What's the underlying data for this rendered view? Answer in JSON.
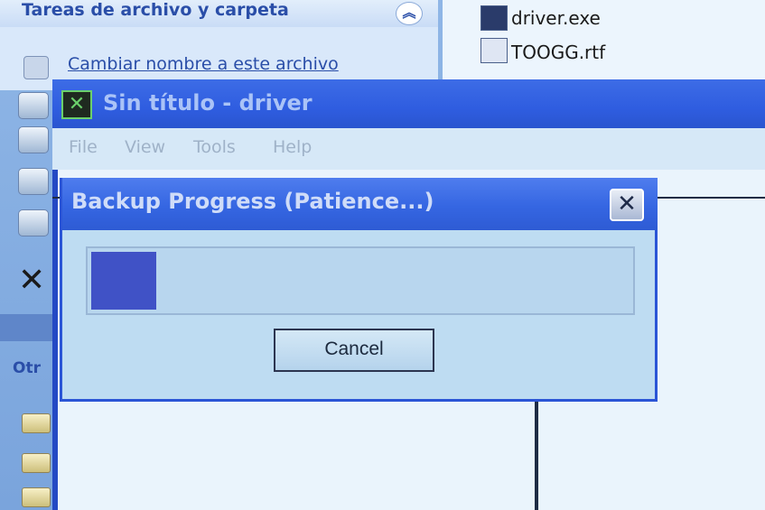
{
  "explorer": {
    "task_pane_title": "Tareas de archivo y carpeta",
    "task_link_rename": "Cambiar nombre a este archivo",
    "other_places_label": "Otr",
    "files": [
      {
        "name": "driver.exe",
        "icon": "executable-file-icon"
      },
      {
        "name": "TOOGG.rtf",
        "icon": "rtf-document-icon"
      }
    ]
  },
  "app": {
    "title": "Sin título - driver",
    "menu": [
      "File",
      "View",
      "Tools",
      "Help"
    ]
  },
  "dialog": {
    "title": "Backup Progress (Patience...)",
    "progress_percent": 12,
    "cancel_label": "Cancel",
    "close_glyph": "✕"
  },
  "colors": {
    "titlebar": "#2f5de0",
    "progress_fill": "#4052c6",
    "dialog_bg": "#bedcf2"
  }
}
